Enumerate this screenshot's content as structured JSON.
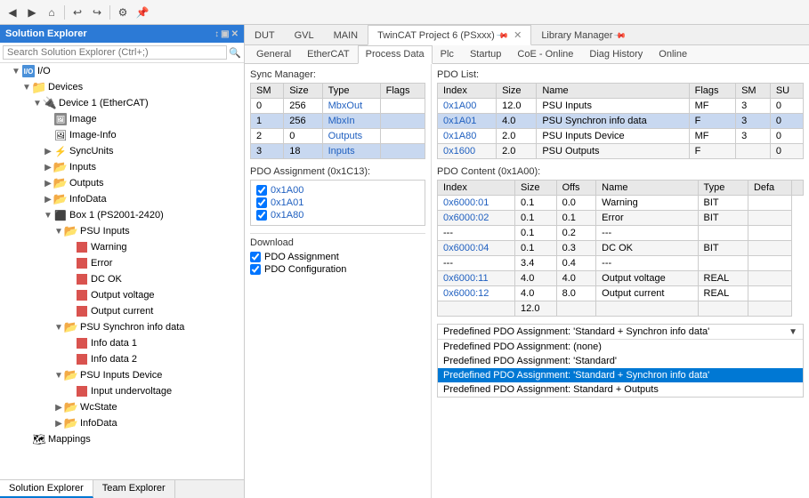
{
  "solution_explorer": {
    "title": "Solution Explorer",
    "search_placeholder": "Search Solution Explorer (Ctrl+;)",
    "tree": [
      {
        "id": "io",
        "label": "I/O",
        "depth": 0,
        "expanded": true,
        "icon": "io",
        "has_arrow": true
      },
      {
        "id": "devices",
        "label": "Devices",
        "depth": 1,
        "expanded": true,
        "icon": "folder_yellow",
        "has_arrow": true
      },
      {
        "id": "device1",
        "label": "Device 1 (EtherCAT)",
        "depth": 2,
        "expanded": true,
        "icon": "device",
        "has_arrow": true
      },
      {
        "id": "image",
        "label": "Image",
        "depth": 3,
        "expanded": false,
        "icon": "img",
        "has_arrow": false
      },
      {
        "id": "imageinfo",
        "label": "Image-Info",
        "depth": 3,
        "expanded": false,
        "icon": "img",
        "has_arrow": false
      },
      {
        "id": "syncunits",
        "label": "SyncUnits",
        "depth": 3,
        "expanded": false,
        "icon": "sync",
        "has_arrow": true
      },
      {
        "id": "inputs",
        "label": "Inputs",
        "depth": 3,
        "expanded": false,
        "icon": "folder_orange",
        "has_arrow": true
      },
      {
        "id": "outputs",
        "label": "Outputs",
        "depth": 3,
        "expanded": false,
        "icon": "folder_orange",
        "has_arrow": true
      },
      {
        "id": "infodata",
        "label": "InfoData",
        "depth": 3,
        "expanded": false,
        "icon": "folder_blue",
        "has_arrow": true
      },
      {
        "id": "box1",
        "label": "Box 1 (PS2001-2420)",
        "depth": 3,
        "expanded": true,
        "icon": "device_green",
        "has_arrow": true
      },
      {
        "id": "psu_inputs",
        "label": "PSU Inputs",
        "depth": 4,
        "expanded": true,
        "icon": "folder_orange",
        "has_arrow": true
      },
      {
        "id": "warning",
        "label": "Warning",
        "depth": 5,
        "expanded": false,
        "icon": "red_sq",
        "has_arrow": false
      },
      {
        "id": "error",
        "label": "Error",
        "depth": 5,
        "expanded": false,
        "icon": "red_sq",
        "has_arrow": false
      },
      {
        "id": "dcok",
        "label": "DC OK",
        "depth": 5,
        "expanded": false,
        "icon": "red_sq",
        "has_arrow": false
      },
      {
        "id": "outvol",
        "label": "Output voltage",
        "depth": 5,
        "expanded": false,
        "icon": "red_sq",
        "has_arrow": false
      },
      {
        "id": "outcur",
        "label": "Output current",
        "depth": 5,
        "expanded": false,
        "icon": "red_sq",
        "has_arrow": false
      },
      {
        "id": "psu_sync",
        "label": "PSU Synchron info data",
        "depth": 4,
        "expanded": true,
        "icon": "folder_orange",
        "has_arrow": true
      },
      {
        "id": "infodata1",
        "label": "Info data 1",
        "depth": 5,
        "expanded": false,
        "icon": "red_sq",
        "has_arrow": false
      },
      {
        "id": "infodata2",
        "label": "Info data 2",
        "depth": 5,
        "expanded": false,
        "icon": "red_sq",
        "has_arrow": false
      },
      {
        "id": "psu_inputs_dev",
        "label": "PSU Inputs Device",
        "depth": 4,
        "expanded": true,
        "icon": "folder_orange",
        "has_arrow": true
      },
      {
        "id": "input_under",
        "label": "Input undervoltage",
        "depth": 5,
        "expanded": false,
        "icon": "red_sq",
        "has_arrow": false
      },
      {
        "id": "wcstate",
        "label": "WcState",
        "depth": 4,
        "expanded": false,
        "icon": "folder_blue",
        "has_arrow": true
      },
      {
        "id": "infodata_box",
        "label": "InfoData",
        "depth": 4,
        "expanded": false,
        "icon": "folder_blue",
        "has_arrow": true
      },
      {
        "id": "mappings",
        "label": "Mappings",
        "depth": 1,
        "expanded": false,
        "icon": "map",
        "has_arrow": false
      }
    ],
    "bottom_tabs": [
      "Solution Explorer",
      "Team Explorer"
    ]
  },
  "tabs": {
    "main_tabs": [
      {
        "label": "DUT",
        "active": false,
        "pinned": false
      },
      {
        "label": "GVL",
        "active": false,
        "pinned": false
      },
      {
        "label": "MAIN",
        "active": false,
        "pinned": false
      },
      {
        "label": "TwinCAT Project 6 (PSxxx)",
        "active": true,
        "pinned": true,
        "closable": true
      },
      {
        "label": "Library Manager",
        "active": false,
        "pinned": true,
        "closable": false
      }
    ],
    "inner_tabs": [
      "General",
      "EtherCAT",
      "Process Data",
      "Plc",
      "Startup",
      "CoE - Online",
      "Diag History",
      "Online"
    ],
    "active_inner": "Process Data"
  },
  "sync_manager": {
    "title": "Sync Manager:",
    "columns": [
      "SM",
      "Size",
      "Type",
      "Flags"
    ],
    "rows": [
      {
        "sm": "0",
        "size": "256",
        "type": "MbxOut",
        "flags": "",
        "highlight": false
      },
      {
        "sm": "1",
        "size": "256",
        "type": "MbxIn",
        "flags": "",
        "highlight": true
      },
      {
        "sm": "2",
        "size": "0",
        "type": "Outputs",
        "flags": "",
        "highlight": false
      },
      {
        "sm": "3",
        "size": "18",
        "type": "Inputs",
        "flags": "",
        "highlight": true
      }
    ]
  },
  "pdo_list": {
    "title": "PDO List:",
    "columns": [
      "Index",
      "Size",
      "Name",
      "Flags",
      "SM",
      "SU"
    ],
    "rows": [
      {
        "index": "0x1A00",
        "size": "12.0",
        "name": "PSU Inputs",
        "flags": "MF",
        "sm": "3",
        "su": "0",
        "highlight": false
      },
      {
        "index": "0x1A01",
        "size": "4.0",
        "name": "PSU Synchron info data",
        "flags": "F",
        "sm": "3",
        "su": "0",
        "highlight": true
      },
      {
        "index": "0x1A80",
        "size": "2.0",
        "name": "PSU Inputs Device",
        "flags": "MF",
        "sm": "3",
        "su": "0",
        "highlight": false
      },
      {
        "index": "0x1600",
        "size": "2.0",
        "name": "PSU Outputs",
        "flags": "F",
        "sm": "",
        "su": "0",
        "highlight": false
      }
    ]
  },
  "pdo_assignment": {
    "title": "PDO Assignment (0x1C13):",
    "items": [
      {
        "label": "0x1A00",
        "checked": true
      },
      {
        "label": "0x1A01",
        "checked": true
      },
      {
        "label": "0x1A80",
        "checked": true
      }
    ]
  },
  "pdo_content": {
    "title": "PDO Content (0x1A00):",
    "columns": [
      "Index",
      "Size",
      "Offs",
      "Name",
      "Type",
      "Defa"
    ],
    "rows": [
      {
        "index": "0x6000:01",
        "size": "0.1",
        "offs": "0.0",
        "name": "Warning",
        "type": "BIT",
        "defa": "",
        "highlight": false
      },
      {
        "index": "0x6000:02",
        "size": "0.1",
        "offs": "0.1",
        "name": "Error",
        "type": "BIT",
        "defa": "",
        "highlight": false
      },
      {
        "index": "---",
        "size": "0.1",
        "offs": "0.2",
        "name": "---",
        "type": "",
        "defa": "",
        "highlight": false
      },
      {
        "index": "0x6000:04",
        "size": "0.1",
        "offs": "0.3",
        "name": "DC OK",
        "type": "BIT",
        "defa": "",
        "highlight": false
      },
      {
        "index": "---",
        "size": "3.4",
        "offs": "0.4",
        "name": "---",
        "type": "",
        "defa": "",
        "highlight": false
      },
      {
        "index": "0x6000:11",
        "size": "4.0",
        "offs": "4.0",
        "name": "Output voltage",
        "type": "REAL",
        "defa": "",
        "highlight": false
      },
      {
        "index": "0x6000:12",
        "size": "4.0",
        "offs": "8.0",
        "name": "Output current",
        "type": "REAL",
        "defa": "",
        "highlight": false
      },
      {
        "index": "",
        "size": "12.0",
        "offs": "",
        "name": "",
        "type": "",
        "defa": "",
        "highlight": false
      }
    ]
  },
  "download": {
    "title": "Download",
    "items": [
      {
        "label": "PDO Assignment",
        "checked": true
      },
      {
        "label": "PDO Configuration",
        "checked": true
      }
    ]
  },
  "predefined_dropdown": {
    "current": "Predefined PDO Assignment: 'Standard + Synchron info data'",
    "options": [
      {
        "label": "Predefined PDO Assignment: (none)",
        "selected": false
      },
      {
        "label": "Predefined PDO Assignment: 'Standard'",
        "selected": false
      },
      {
        "label": "Predefined PDO Assignment: 'Standard + Synchron info data'",
        "selected": true
      },
      {
        "label": "Predefined PDO Assignment: Standard + Outputs",
        "selected": false
      }
    ]
  }
}
